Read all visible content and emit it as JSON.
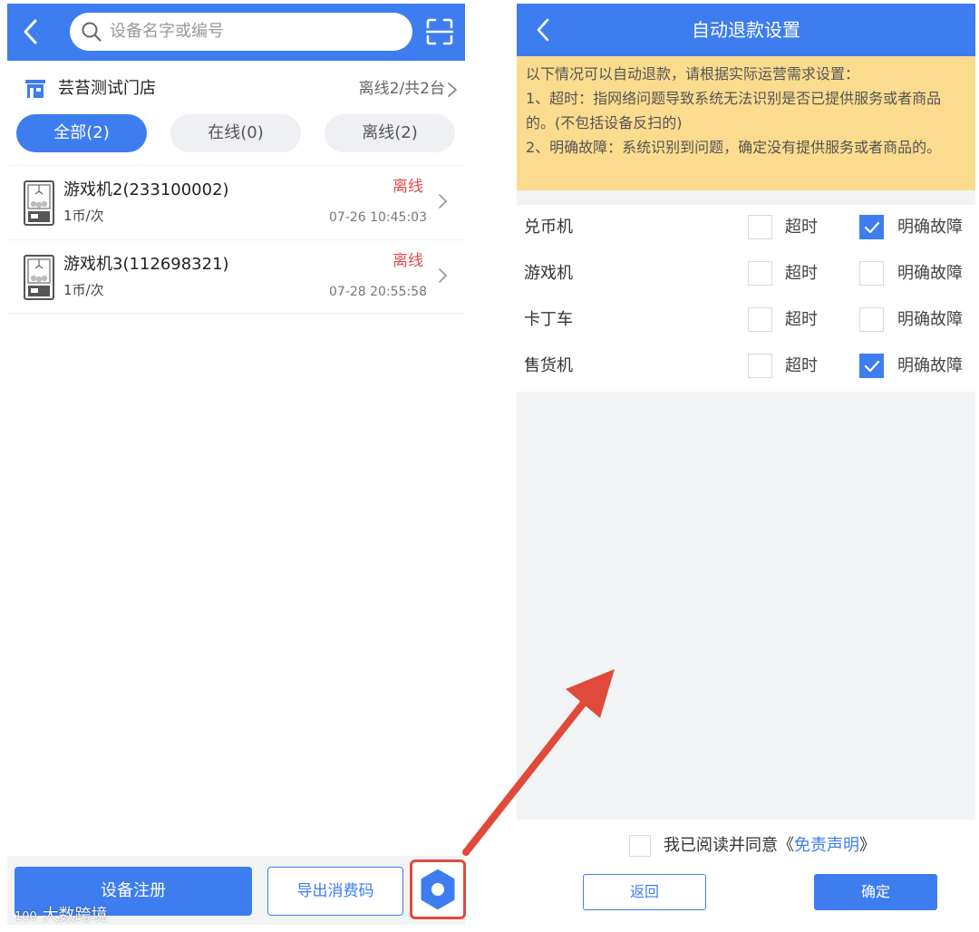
{
  "left": {
    "search_placeholder": "设备名字或编号",
    "store": {
      "name": "芸苔测试门店",
      "count": "离线2/共2台"
    },
    "tabs": [
      {
        "label": "全部(2)",
        "active": true
      },
      {
        "label": "在线(0)",
        "active": false
      },
      {
        "label": "离线(2)",
        "active": false
      }
    ],
    "devices": [
      {
        "name": "游戏机2(233100002)",
        "price": "1币/次",
        "status": "离线",
        "time": "07-26 10:45:03"
      },
      {
        "name": "游戏机3(112698321)",
        "price": "1币/次",
        "status": "离线",
        "time": "07-28 20:55:58"
      }
    ],
    "register_label": "设备注册",
    "export_label": "导出消费码",
    "watermark": "大数跨境",
    "watermark_prefix": "100"
  },
  "right": {
    "title": "自动退款设置",
    "notice": [
      "以下情况可以自动退款，请根据实际运营需求设置：",
      "1、超时：指网络问题导致系统无法识别是否已提供服务或者商品的。(不包括设备反扫的)",
      "2、明确故障：系统识别到问题，确定没有提供服务或者商品的。"
    ],
    "rows": [
      {
        "label": "兑币机",
        "opt1": "超时",
        "opt1_checked": false,
        "opt2": "明确故障",
        "opt2_checked": true
      },
      {
        "label": "游戏机",
        "opt1": "超时",
        "opt1_checked": false,
        "opt2": "明确故障",
        "opt2_checked": false
      },
      {
        "label": "卡丁车",
        "opt1": "超时",
        "opt1_checked": false,
        "opt2": "明确故障",
        "opt2_checked": false
      },
      {
        "label": "售货机",
        "opt1": "超时",
        "opt1_checked": false,
        "opt2": "明确故障",
        "opt2_checked": true
      }
    ],
    "agree_text": "我已阅读并同意《",
    "agree_link": "免责声明",
    "agree_end": "》",
    "agree_checked": false,
    "back_label": "返回",
    "confirm_label": "确定"
  },
  "colors": {
    "primary": "#3d7df0",
    "offline": "#e24b4b",
    "notice_bg": "#fbdc8e",
    "highlight": "#e14a3a"
  }
}
